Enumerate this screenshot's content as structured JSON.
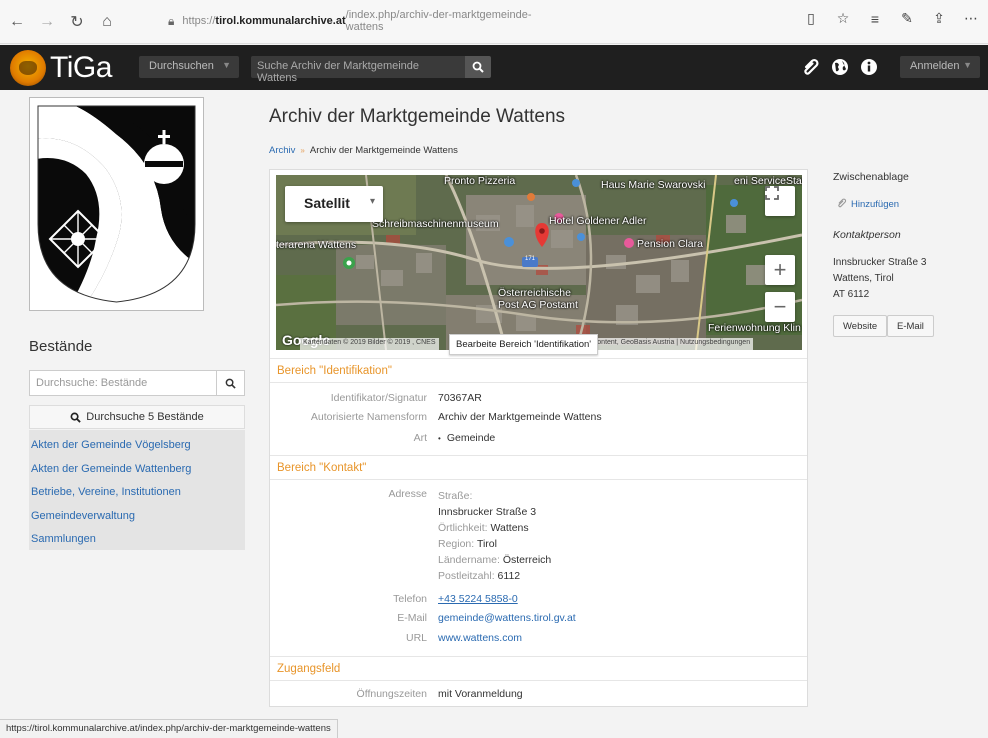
{
  "browser": {
    "url_prefix": "https://",
    "url_host": "tirol.kommunalarchive.at",
    "url_path": "/index.php/archiv-der-marktgemeinde-wattens",
    "status_url": "https://tirol.kommunalarchive.at/index.php/archiv-der-marktgemeinde-wattens"
  },
  "nav": {
    "logo_text": "TiGa",
    "browse_label": "Durchsuchen",
    "search_placeholder": "Suche Archiv der Marktgemeinde Wattens",
    "login_label": "Anmelden"
  },
  "sidebar": {
    "title": "Bestände",
    "search_placeholder": "Durchsuche: Bestände",
    "browse_button": "Durchsuche 5 Bestände",
    "items": [
      {
        "label": "Akten der Gemeinde Vögelsberg"
      },
      {
        "label": "Akten der Gemeinde Wattenberg"
      },
      {
        "label": "Betriebe, Vereine, Institutionen"
      },
      {
        "label": "Gemeindeverwaltung"
      },
      {
        "label": "Sammlungen"
      }
    ]
  },
  "main": {
    "title": "Archiv der Marktgemeinde Wattens",
    "breadcrumb": {
      "root": "Archiv",
      "current": "Archiv der Marktgemeinde Wattens"
    },
    "map": {
      "type_button": "Satellit",
      "labels": {
        "pizzeria": "Pronto Pizzeria",
        "swarovski": "Haus Marie Swarovski",
        "station": "eni ServiceStation",
        "museum": "Schreibmaschinenmuseum",
        "hotel": "Hotel Goldener Adler",
        "arena": "terarena Wattens",
        "pension": "Pension Clara",
        "road": "171",
        "post1": "Österreichische",
        "post2": "Post AG Postamt",
        "ferien": "Ferienwohnung Klin"
      },
      "watermark": "Google",
      "attribution_left": "Kartendaten © 2019 Bilder © 2019 , CNES",
      "attribution_right": "GeoContent, GeoBasis Austria | Nutzungsbedingungen",
      "tooltip": "Bearbeite Bereich 'Identifikation'"
    },
    "sections": {
      "identification": {
        "title": "Bereich \"Identifikation\"",
        "rows": [
          {
            "label": "Identifikator/Signatur",
            "value": "70367AR"
          },
          {
            "label": "Autorisierte Namensform",
            "value": "Archiv der Marktgemeinde Wattens"
          },
          {
            "label": "Art",
            "value": "Gemeinde"
          }
        ]
      },
      "contact": {
        "title": "Bereich \"Kontakt\"",
        "address_label": "Adresse",
        "street_label": "Straße:",
        "street": "Innsbrucker Straße 3",
        "locality_label": "Örtlichkeit:",
        "locality": "Wattens",
        "region_label": "Region:",
        "region": "Tirol",
        "country_label": "Ländername:",
        "country": "Österreich",
        "postcode_label": "Postleitzahl:",
        "postcode": "6112",
        "phone_label": "Telefon",
        "phone": "+43 5224 5858-0",
        "email_label": "E-Mail",
        "email": "gemeinde@wattens.tirol.gv.at",
        "url_label": "URL",
        "url": "www.wattens.com"
      },
      "access": {
        "title": "Zugangsfeld",
        "hours_label": "Öffnungszeiten",
        "hours": "mit Voranmeldung"
      }
    }
  },
  "right": {
    "clipboard_title": "Zwischenablage",
    "clipboard_add": "Hinzufügen",
    "contact_title": "Kontaktperson",
    "address_line1": "Innsbrucker Straße 3",
    "address_line2": "Wattens, Tirol",
    "address_line3": "AT 6112",
    "website_button": "Website",
    "email_button": "E-Mail"
  },
  "colors": {
    "navbar": "#1f1f1f",
    "link": "#2a6ab1",
    "section_heading": "#e8952a",
    "sidebar_list_bg": "#e4e4e4"
  }
}
